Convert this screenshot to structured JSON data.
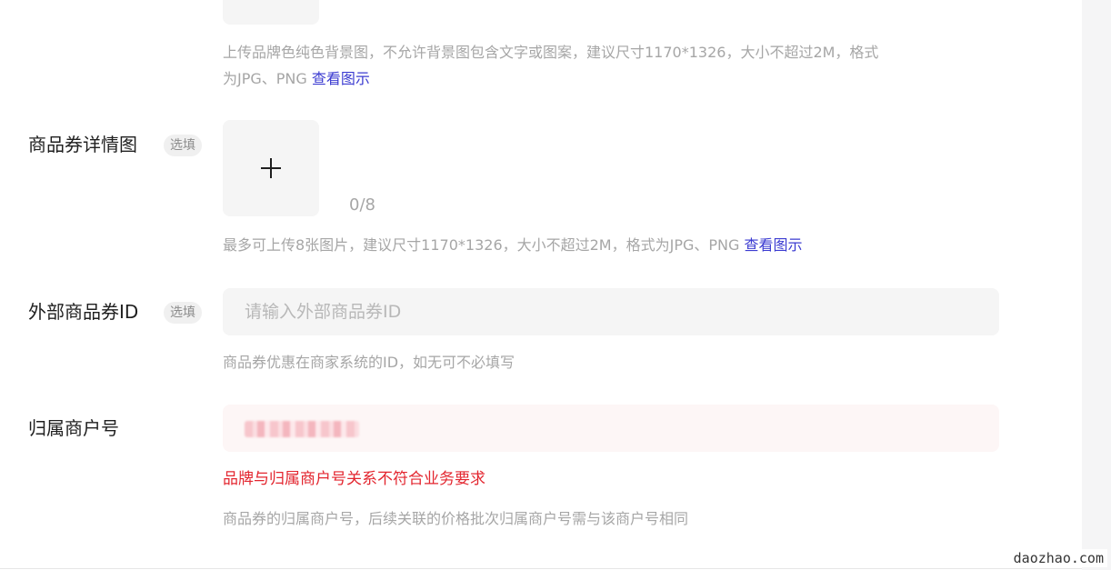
{
  "background_image_section": {
    "hint_line1": "上传品牌色纯色背景图，不允许背景图包含文字或图案，建议尺寸1170*1326，大小不超过2M，格式",
    "hint_line2": "为JPG、PNG",
    "view_example_link": "查看图示"
  },
  "detail_images_section": {
    "label": "商品券详情图",
    "optional_tag": "选填",
    "upload_icon": "plus-icon",
    "counter": "0/8",
    "hint": "最多可上传8张图片，建议尺寸1170*1326，大小不超过2M，格式为JPG、PNG",
    "view_example_link": "查看图示"
  },
  "external_id_section": {
    "label": "外部商品券ID",
    "optional_tag": "选填",
    "placeholder": "请输入外部商品券ID",
    "hint": "商品券优惠在商家系统的ID，如无可不必填写"
  },
  "merchant_section": {
    "label": "归属商户号",
    "error": "品牌与归属商户号关系不符合业务要求",
    "hint": "商品券的归属商户号，后续关联的价格批次归属商户号需与该商户号相同"
  },
  "watermark": "daozhao.com",
  "colors": {
    "link": "#3b3bd1",
    "error": "#e3262f",
    "hint": "#a6a6a6"
  }
}
